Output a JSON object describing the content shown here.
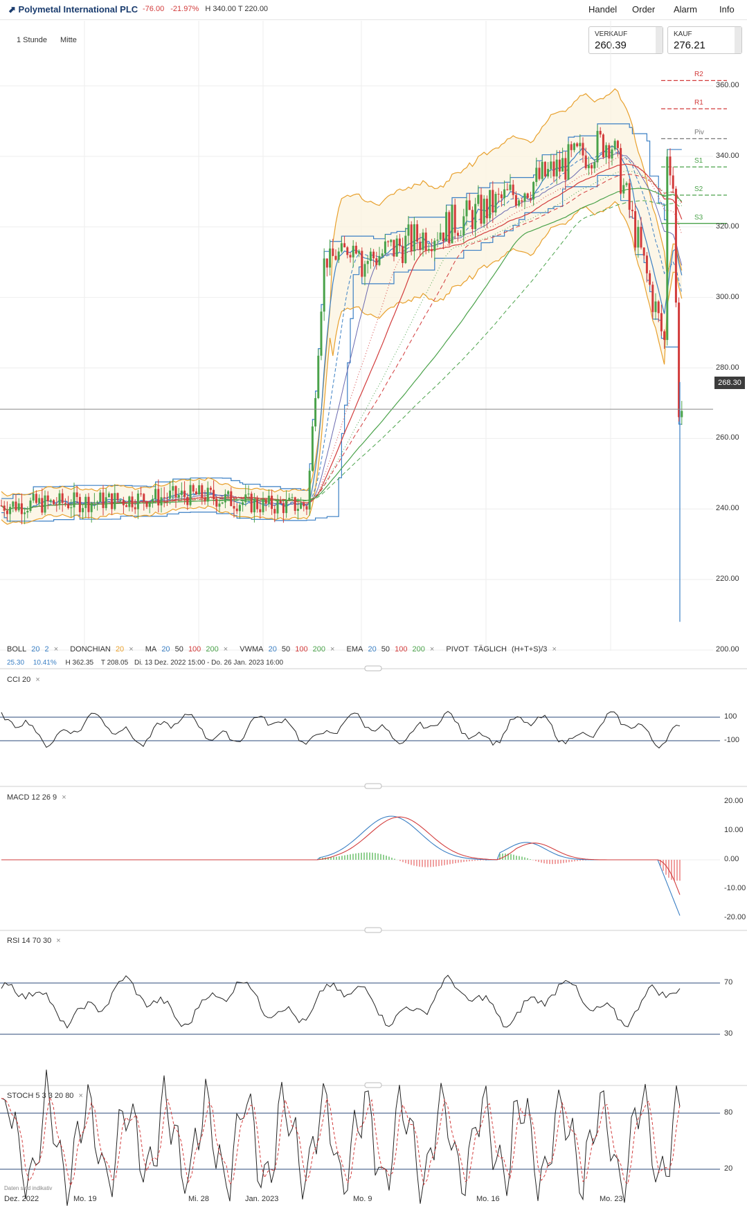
{
  "header": {
    "title": "Polymetal International PLC",
    "change": "-76.00",
    "change_pct": "-21.97%",
    "high": "H 340.00",
    "low": "T 220.00",
    "nav": [
      "Handel",
      "Order",
      "Alarm",
      "Info"
    ],
    "sell_label": "VERKAUF",
    "sell_value": "260.39",
    "buy_label": "KAUF",
    "buy_value": "276.21"
  },
  "toolbar": {
    "timeframe": "1 Stunde",
    "price_type": "Mitte"
  },
  "indicators_legend": {
    "boll": "BOLL",
    "boll_p1": "20",
    "boll_p2": "2",
    "donchian": "DONCHIAN",
    "donchian_p": "20",
    "ma": "MA",
    "ma_p": [
      "20",
      "50",
      "100",
      "200"
    ],
    "vwma": "VWMA",
    "vwma_p": [
      "20",
      "50",
      "100",
      "200"
    ],
    "ema": "EMA",
    "ema_p": [
      "20",
      "50",
      "100",
      "200"
    ],
    "pivot": "PIVOT",
    "pivot_p1": "TÄGLICH",
    "pivot_p2": "(H+T+S)/3",
    "close_icon": "×"
  },
  "info_line": {
    "v1": "25.30",
    "v2": "10.41%",
    "h": "H 362.35",
    "t": "T 208.05",
    "range": "Di. 13 Dez. 2022 15:00 - Do. 26 Jan. 2023 16:00"
  },
  "panels": {
    "cci": {
      "name": "CCI",
      "p": "20"
    },
    "macd": {
      "name": "MACD",
      "p": "12 26 9"
    },
    "rsi": {
      "name": "RSI",
      "p": "14 70 30"
    },
    "stoch": {
      "name": "STOCH",
      "p": "5 3 3 20 80"
    }
  },
  "pivot_labels": [
    "R2",
    "R1",
    "Piv",
    "S1",
    "S2",
    "S3"
  ],
  "current_price_tag": "268.30",
  "price_axis": [
    "360.00",
    "340.00",
    "320.00",
    "300.00",
    "280.00",
    "260.00",
    "240.00",
    "220.00",
    "200.00"
  ],
  "cci_axis": [
    "100",
    "-100"
  ],
  "macd_axis": [
    "20.00",
    "10.00",
    "0.00",
    "-10.00",
    "-20.00"
  ],
  "rsi_axis": [
    "70",
    "30"
  ],
  "stoch_axis": [
    "80",
    "20"
  ],
  "x_axis": [
    "Dez. 2022",
    "Mo. 19",
    "Mi. 28",
    "Jan. 2023",
    "Mo. 9",
    "Mo. 16",
    "Mo. 23"
  ],
  "footnote": "Daten sind indikativ",
  "colors": {
    "up": "#4aa24a",
    "down": "#d23b3b",
    "boll": "#e8a02c",
    "donchian": "#3a7fc4"
  },
  "chart_data": {
    "type": "candlestick",
    "interval": "1 Stunde",
    "y_range": [
      195,
      365
    ],
    "visible_range": "Di. 13 Dez. 2022 15:00 - Do. 26 Jan. 2023 16:00",
    "range_high": 362.35,
    "range_low": 208.05,
    "last_price": 268.3,
    "pivot_levels": {
      "R2": 361.5,
      "R1": 353.5,
      "Piv": 345,
      "S1": 337,
      "S2": 329,
      "S3": 321
    },
    "approx_close_path": [
      {
        "t": "Dez. 2022",
        "close": 241
      },
      {
        "t": "Mo. 19",
        "close": 242
      },
      {
        "t": "Mi. 28",
        "close": 244
      },
      {
        "t": "Jan. 2023",
        "close": 241
      },
      {
        "t": "Mo. 9",
        "close": 310
      },
      {
        "t": "Mo. 16",
        "close": 325
      },
      {
        "t": "Mo. 23",
        "close": 345
      },
      {
        "t": "end",
        "close": 268.3
      }
    ],
    "sub_charts": {
      "CCI": {
        "levels": [
          100,
          -100
        ]
      },
      "MACD": {
        "range": [
          -20,
          20
        ]
      },
      "RSI": {
        "levels": [
          70,
          30
        ]
      },
      "STOCH": {
        "levels": [
          80,
          20
        ]
      }
    }
  }
}
